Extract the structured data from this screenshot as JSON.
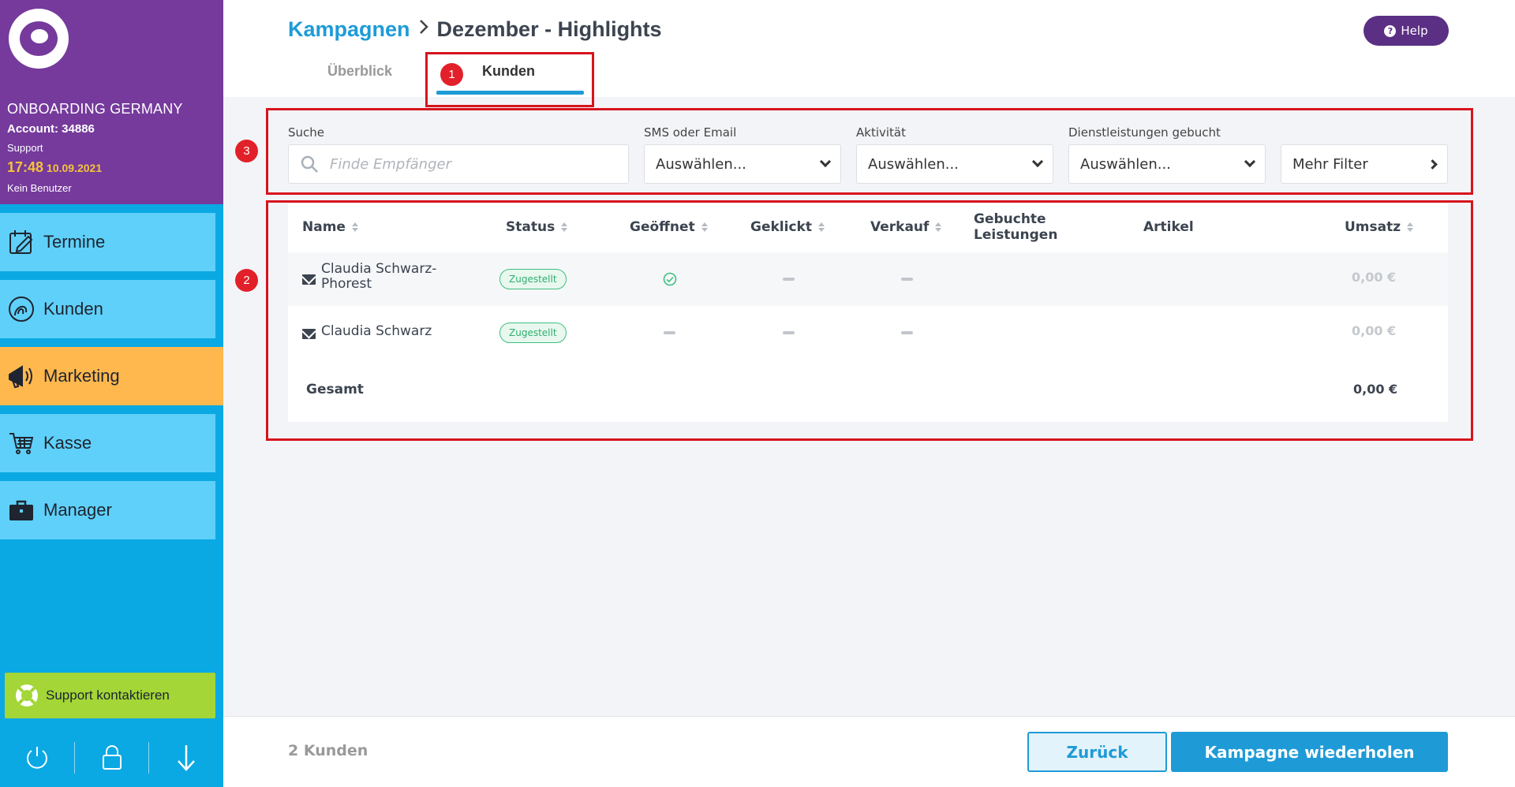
{
  "sidebar": {
    "org_name": "ONBOARDING GERMANY",
    "account": "Account: 34886",
    "role": "Support",
    "time": "17:48",
    "date": "10.09.2021",
    "user": "Kein Benutzer",
    "nav": [
      {
        "label": "Termine",
        "icon": "calendar-icon"
      },
      {
        "label": "Kunden",
        "icon": "customer-icon"
      },
      {
        "label": "Marketing",
        "icon": "megaphone-icon"
      },
      {
        "label": "Kasse",
        "icon": "cart-icon"
      },
      {
        "label": "Manager",
        "icon": "briefcase-icon"
      }
    ],
    "active_nav": "Marketing",
    "support_label": "Support kontaktieren"
  },
  "header": {
    "breadcrumb_root": "Kampagnen",
    "breadcrumb_current": "Dezember - Highlights",
    "help_label": "Help",
    "tabs": [
      {
        "label": "Überblick"
      },
      {
        "label": "Kunden"
      }
    ],
    "active_tab": "Kunden"
  },
  "annotations": [
    "1",
    "2",
    "3"
  ],
  "filters": {
    "search_label": "Suche",
    "search_placeholder": "Finde Empfänger",
    "sms_label": "SMS oder Email",
    "sms_value": "Auswählen...",
    "activity_label": "Aktivität",
    "activity_value": "Auswählen...",
    "services_label": "Dienstleistungen gebucht",
    "services_value": "Auswählen...",
    "more_label": "Mehr Filter"
  },
  "table": {
    "columns": [
      "Name",
      "Status",
      "Geöffnet",
      "Geklickt",
      "Verkauf",
      "Gebuchte",
      "Leistungen",
      "Artikel",
      "Umsatz"
    ],
    "rows": [
      {
        "name_line1": "Claudia Schwarz-",
        "name_line2": "Phorest",
        "status": "Zugestellt",
        "opened": true,
        "revenue": "0,00 €"
      },
      {
        "name_line1": "Claudia Schwarz",
        "name_line2": "",
        "status": "Zugestellt",
        "opened": false,
        "revenue": "0,00 €"
      }
    ],
    "total_label": "Gesamt",
    "total_value": "0,00 €"
  },
  "footer": {
    "count": "2 Kunden",
    "back_label": "Zurück",
    "repeat_label": "Kampagne wiederholen"
  },
  "colors": {
    "sidebar_top": "#753a9c",
    "sidebar": "#0aa9e4",
    "nav_item": "#5fd0f9",
    "nav_active": "#ffb84d",
    "accent": "#1e9bd7",
    "support": "#a3d636",
    "annotation": "#d6141e"
  }
}
